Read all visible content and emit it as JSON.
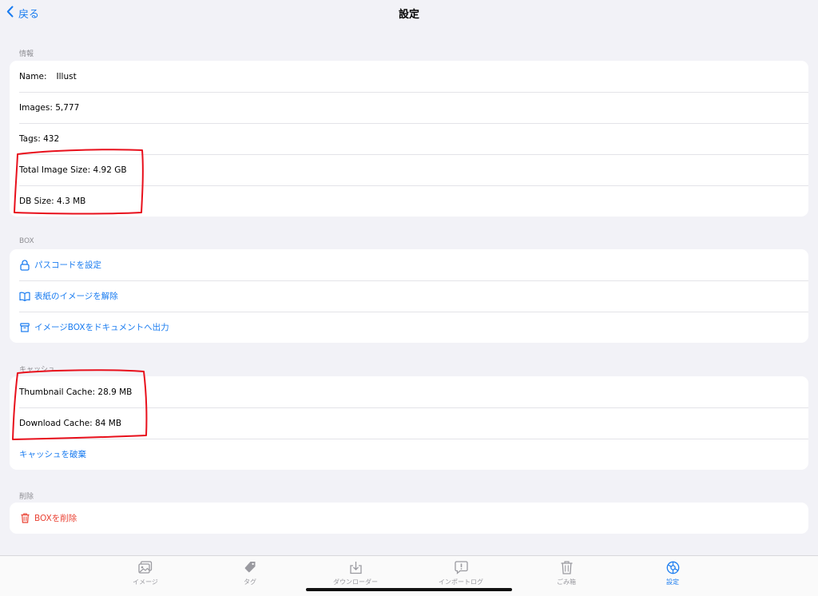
{
  "nav": {
    "back_label": "戻る",
    "title": "設定"
  },
  "info": {
    "header": "情報",
    "name_label": "Name:",
    "name_value": "Illust",
    "images": "Images: 5,777",
    "tags": "Tags: 432",
    "total_image_size": "Total Image Size: 4.92 GB",
    "db_size": "DB Size: 4.3 MB"
  },
  "box": {
    "header": "BOX",
    "items": [
      {
        "label": "パスコードを設定",
        "icon": "lock-icon"
      },
      {
        "label": "表紙のイメージを解除",
        "icon": "book-icon"
      },
      {
        "label": "イメージBOXをドキュメントへ出力",
        "icon": "archive-box-icon"
      }
    ]
  },
  "cache": {
    "header": "キャッシュ",
    "thumbnail": "Thumbnail Cache: 28.9 MB",
    "download": "Download Cache: 84 MB",
    "clear_label": "キャッシュを破棄"
  },
  "delete": {
    "header": "削除",
    "delete_label": "BOXを削除",
    "icon": "trash-icon"
  },
  "tabbar": {
    "tabs": [
      {
        "label": "イメージ",
        "icon": "photo-icon"
      },
      {
        "label": "タグ",
        "icon": "tag-icon"
      },
      {
        "label": "ダウンローダー",
        "icon": "download-icon"
      },
      {
        "label": "インポートログ",
        "icon": "alert-bubble-icon"
      },
      {
        "label": "ごみ箱",
        "icon": "trash-icon"
      },
      {
        "label": "設定",
        "icon": "settings-icon"
      }
    ],
    "active_tab": "設定"
  },
  "colors": {
    "accent": "#1a7cf0",
    "danger": "#ea4335",
    "annotation": "#e8101c",
    "background": "#f2f2f7"
  }
}
